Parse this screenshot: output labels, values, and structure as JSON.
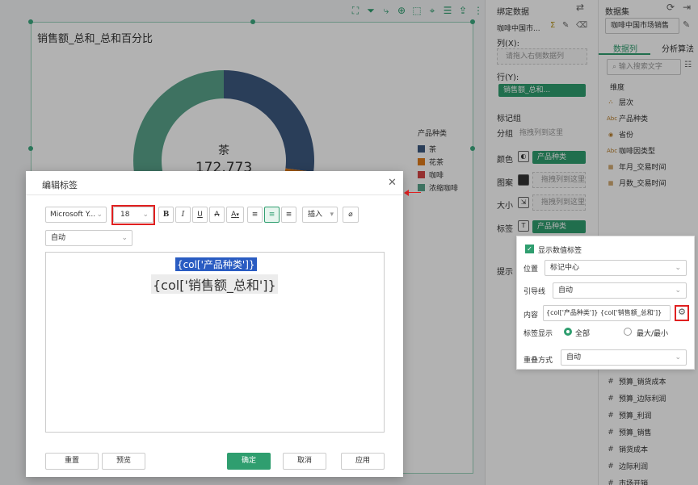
{
  "chart": {
    "title": "销售额_总和_总和百分比",
    "center_label": "茶",
    "center_value": "172,773",
    "legend_title": "产品种类"
  },
  "chart_data": {
    "type": "pie",
    "title": "销售额_总和_总和百分比",
    "categories": [
      "茶",
      "花茶",
      "咖啡",
      "浓缩咖啡"
    ],
    "values": [
      27,
      12,
      4,
      57
    ],
    "colors": [
      "#3d5a80",
      "#e07b1a",
      "#d64545",
      "#5aa48c"
    ],
    "donut": true,
    "legend_title": "产品种类",
    "legend_position": "right"
  },
  "bind_panel": {
    "title": "绑定数据",
    "dataset": "咖啡中国市...",
    "col_label": "列(X):",
    "col_placeholder": "请拖入右侧数据列",
    "row_label": "行(Y):",
    "row_chip": "销售额_总和...",
    "mark_group": "标记组",
    "group_label": "分组",
    "group_placeholder": "拖拽列到这里",
    "color_label": "颜色",
    "color_chip": "产品种类",
    "shape_label": "图案",
    "shape_placeholder": "拖拽列到这里",
    "size_label": "大小",
    "size_placeholder": "拖拽列到这里",
    "tag_label": "标签",
    "tag_chip": "产品种类",
    "tip_label": "提示"
  },
  "ds_panel": {
    "title": "数据集",
    "dataset": "咖啡中国市场销售",
    "tab_columns": "数据列",
    "tab_algo": "分析算法",
    "search_placeholder": "输入搜索文字",
    "dimension": "维度",
    "dims": [
      "层次",
      "产品种类",
      "省份",
      "咖啡因类型",
      "年月_交易时间",
      "月数_交易时间"
    ],
    "measures": [
      "预算_销货成本",
      "预算_边际利润",
      "预算_利润",
      "预算_销售",
      "销货成本",
      "边际利润",
      "市场开销"
    ]
  },
  "label_popup": {
    "show_values": "显示数值标签",
    "position_label": "位置",
    "position_value": "标记中心",
    "guide_label": "引导线",
    "guide_value": "自动",
    "content_label": "内容",
    "content_value": "{col['产品种类']} {col['销售额_总和']}",
    "display_label": "标签显示",
    "opt_all": "全部",
    "opt_minmax": "最大/最小",
    "overlap_label": "重叠方式",
    "overlap_value": "自动"
  },
  "dialog": {
    "title": "编辑标签",
    "font_family": "Microsoft Y...",
    "font_size": "18",
    "insert": "插入",
    "auto": "自动",
    "line1": "{col['产品种类']}",
    "line2": "{col['销售额_总和']}",
    "reset": "重置",
    "preview": "预览",
    "ok": "确定",
    "cancel": "取消",
    "apply": "应用"
  },
  "colors": {
    "accent": "#2f9e6f",
    "highlight": "#e02020"
  }
}
